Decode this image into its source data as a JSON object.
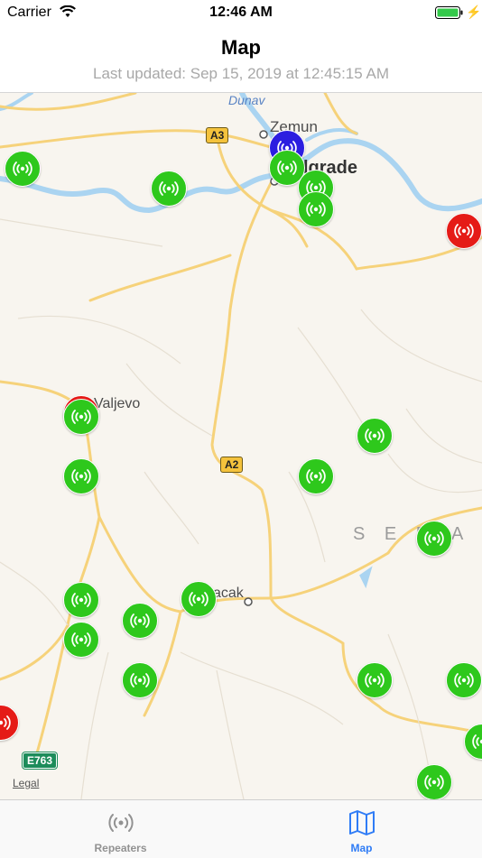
{
  "status_bar": {
    "carrier": "Carrier",
    "time": "12:46 AM"
  },
  "header": {
    "title": "Map",
    "subtitle": "Last updated: Sep 15, 2019 at 12:45:15 AM"
  },
  "map": {
    "place_labels": [
      "Zemun",
      "lgrade",
      "Valjevo",
      "acak"
    ],
    "river_label": "Dunav",
    "country_label": "SERBIA",
    "country_label_visible": "S E R",
    "country_label_tail": "A",
    "highway_labels": [
      "A3",
      "A2",
      "E763"
    ],
    "legal_label": "Legal",
    "pin_colors": {
      "green": "#2ec81c",
      "red": "#e51b17",
      "blue": "#2c1ee0"
    },
    "repeaters": [
      {
        "status": "green"
      },
      {
        "status": "green"
      },
      {
        "status": "blue"
      },
      {
        "status": "green"
      },
      {
        "status": "green"
      },
      {
        "status": "green"
      },
      {
        "status": "red"
      },
      {
        "status": "red"
      },
      {
        "status": "green"
      },
      {
        "status": "green"
      },
      {
        "status": "green"
      },
      {
        "status": "green"
      },
      {
        "status": "green"
      },
      {
        "status": "green"
      },
      {
        "status": "green"
      },
      {
        "status": "green"
      },
      {
        "status": "green"
      },
      {
        "status": "green"
      },
      {
        "status": "green"
      },
      {
        "status": "green"
      },
      {
        "status": "red"
      },
      {
        "status": "green"
      },
      {
        "status": "green"
      }
    ]
  },
  "tabs": [
    {
      "label": "Repeaters",
      "icon": "antenna-icon",
      "selected": false
    },
    {
      "label": "Map",
      "icon": "map-icon",
      "selected": true
    }
  ],
  "colors": {
    "accent": "#2f7cf6",
    "inactive": "#929292"
  }
}
